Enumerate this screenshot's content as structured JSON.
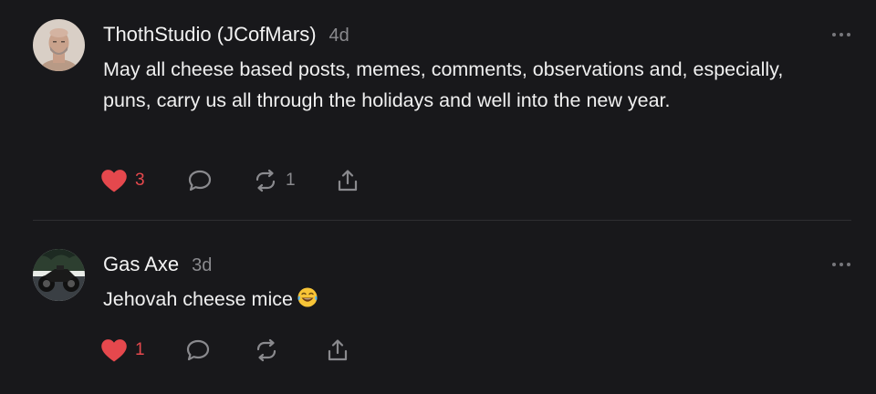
{
  "posts": [
    {
      "username": "ThothStudio (JCofMars)",
      "time": "4d",
      "text": "May all cheese based posts, memes, comments, observations and, especially, puns, carry us all through the holidays and well into the new year.",
      "likes": "3",
      "reposts": "1",
      "liked": true
    },
    {
      "username": "Gas Axe",
      "time": "3d",
      "text": "Jehovah cheese mice",
      "emoji": "😂",
      "likes": "1",
      "reposts": "",
      "liked": true
    }
  ],
  "icons": {
    "like": "heart-icon",
    "reply": "speech-bubble-icon",
    "repost": "repost-arrows-icon",
    "share": "share-icon",
    "more": "more-dots-icon"
  },
  "colors": {
    "background": "#18181b",
    "liked": "#e5484d",
    "muted": "#8a8a8e",
    "divider": "#2e2e32"
  }
}
